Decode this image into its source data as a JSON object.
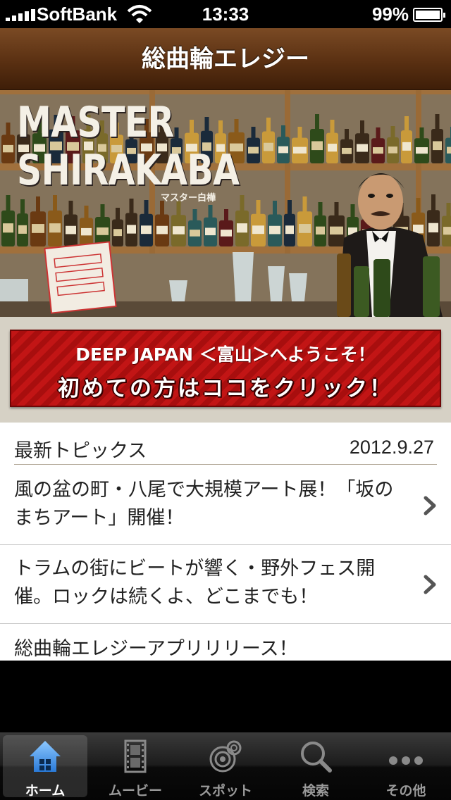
{
  "status_bar": {
    "carrier": "SoftBank",
    "time": "13:33",
    "battery": "99%",
    "battery_level": 0.99
  },
  "nav": {
    "title": "総曲輪エレジー"
  },
  "hero": {
    "title_line1": "MASTER",
    "title_line2": "SHIRAKABA",
    "subtitle": "マスター白樺"
  },
  "welcome": {
    "line1": "DEEP JAPAN ＜富山＞へようこそ！",
    "line2": "初めての方はココをクリック！"
  },
  "topics": {
    "heading": "最新トピックス",
    "date": "2012.9.27",
    "items": [
      {
        "line1": "風の盆の町・八尾で大規模アート展！「坂の",
        "line2": "まちアート」開催！"
      },
      {
        "line1": "トラムの街にビートが響く・野外フェス開",
        "line2": "催。ロックは続くよ、どこまでも！"
      },
      {
        "line1": "総曲輪エレジーアプリリリース！",
        "line2": ""
      }
    ]
  },
  "tabs": [
    {
      "label": "ホーム",
      "icon": "home-icon",
      "selected": true
    },
    {
      "label": "ムービー",
      "icon": "film-icon",
      "selected": false
    },
    {
      "label": "スポット",
      "icon": "spot-icon",
      "selected": false
    },
    {
      "label": "検索",
      "icon": "search-icon",
      "selected": false
    },
    {
      "label": "その他",
      "icon": "more-icon",
      "selected": false
    }
  ],
  "colors": {
    "nav_brown": "#5a3012",
    "banner_red": "#c21515",
    "tab_active_blue": "#3a8fe0"
  }
}
